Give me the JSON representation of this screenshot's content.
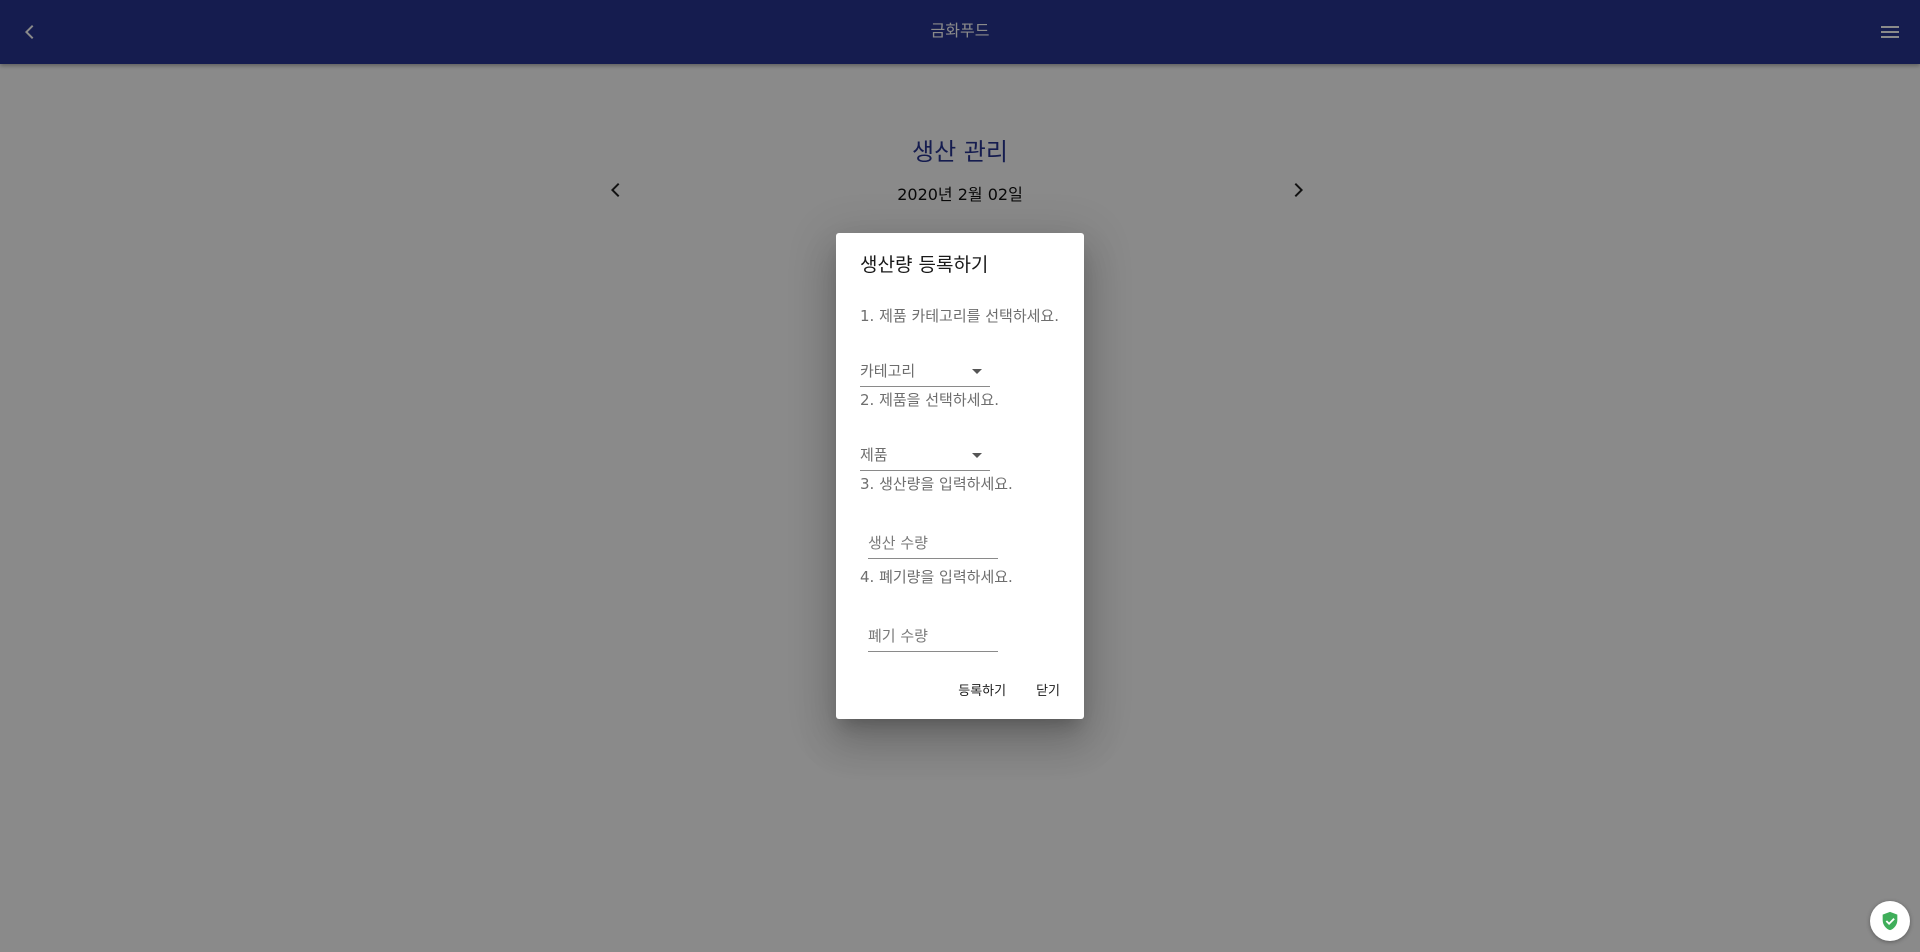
{
  "app": {
    "title": "금화푸드"
  },
  "page": {
    "title": "생산 관리",
    "date": "2020년 2월 02일"
  },
  "dialog": {
    "title": "생산량 등록하기",
    "step1": "1. 제품 카테고리를 선택하세요.",
    "category_select": "카테고리",
    "step2": "2. 제품을 선택하세요.",
    "product_select": "제품",
    "step3": "3. 생산량을 입력하세요.",
    "production_placeholder": "생산 수량",
    "step4": "4. 폐기량을 입력하세요.",
    "waste_placeholder": "폐기 수량",
    "register_label": "등록하기",
    "close_label": "닫기"
  },
  "icons": {
    "back": "chevron-left-icon",
    "menu": "hamburger-menu-icon",
    "prev": "chevron-left-icon",
    "next": "chevron-right-icon",
    "dropdown": "caret-down-icon",
    "shield": "shield-check-icon"
  },
  "colors": {
    "primary": "#283593",
    "shield": "#3fae5a"
  }
}
